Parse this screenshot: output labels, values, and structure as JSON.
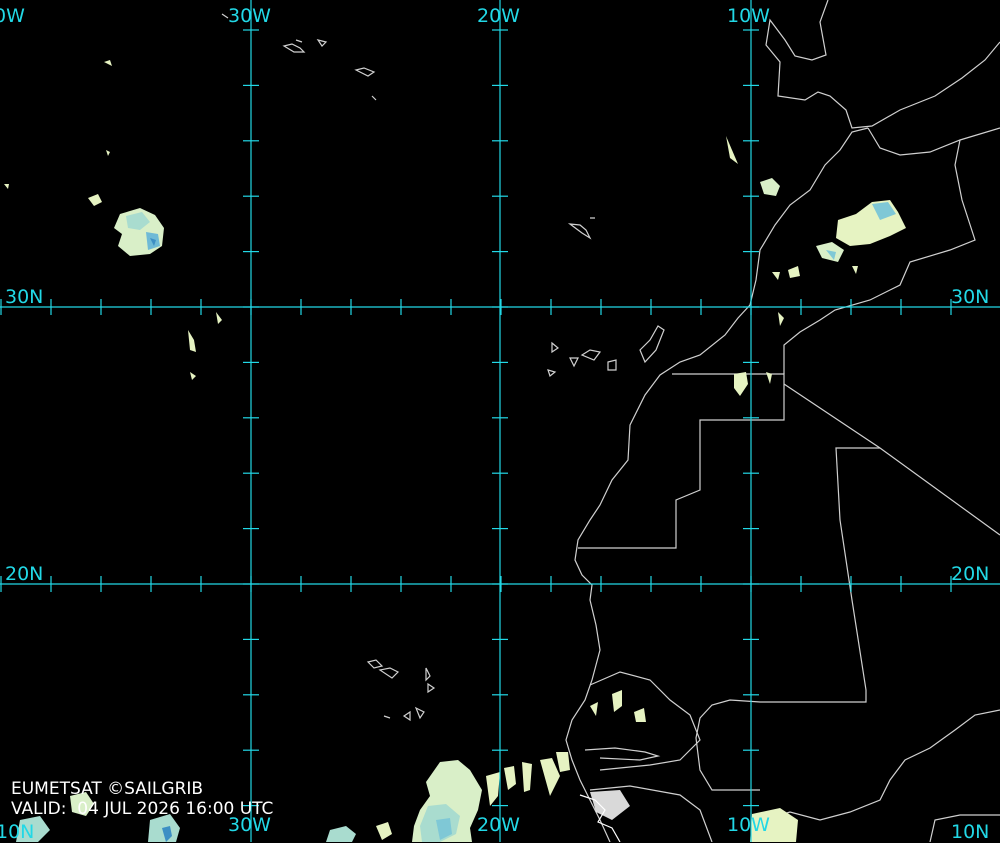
{
  "map": {
    "credit_line": "EUMETSAT ©SAILGRIB",
    "valid_prefix": "VALID:",
    "valid_value": "04 JUL 2026 16:00 UTC",
    "grid_color": "#22d8e6",
    "coast_color": "#d0d0d0",
    "cloud_colors": [
      "#e6f3c2",
      "#bfe7cf",
      "#7fc8d6",
      "#3d8fc4"
    ],
    "longitude_labels_top": [
      "0W",
      "30W",
      "20W",
      "10W"
    ],
    "longitude_labels_bottom": [
      "10N",
      "30W",
      "20W",
      "10W",
      "10N"
    ],
    "latitude_labels_left": [
      "30N",
      "20N"
    ],
    "latitude_labels_right": [
      "30N",
      "20N"
    ]
  }
}
